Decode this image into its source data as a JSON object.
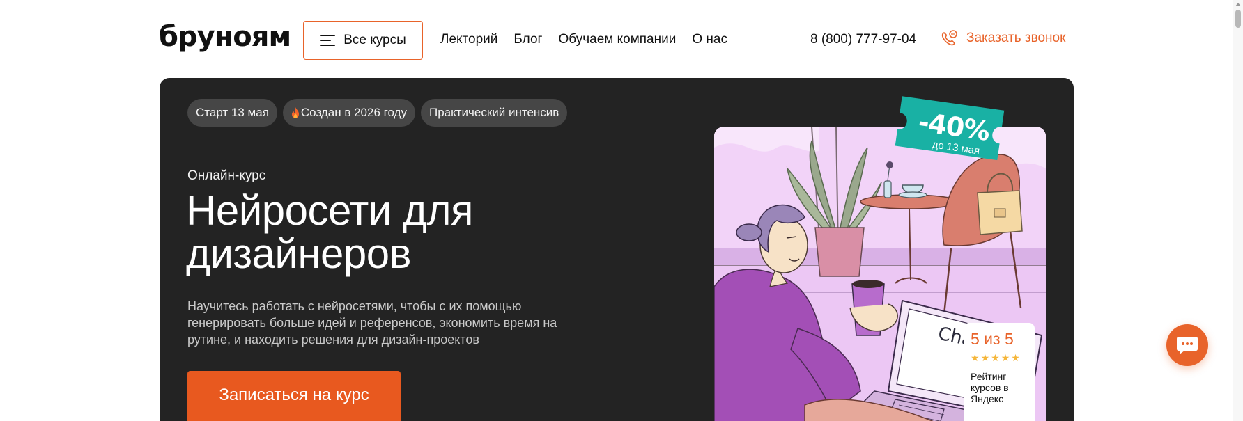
{
  "header": {
    "logo": "бруноям",
    "all_courses_label": "Все курсы",
    "nav": [
      "Лекторий",
      "Блог",
      "Обучаем компании",
      "О нас"
    ],
    "phone": "8 (800) 777-97-04",
    "callback_label": "Заказать звонок"
  },
  "hero": {
    "tags": [
      "Старт 13 мая",
      "Создан в 2026 году",
      "Практический интенсив"
    ],
    "subtitle": "Онлайн-курс",
    "title": "Нейросети для дизайнеров",
    "description": "Научитесь работать с нейросетями, чтобы с их помощью генерировать больше идей и референсов, экономить время на рутине, и находить решения для дизайн-проектов",
    "cta_label": "Записаться на курс"
  },
  "promo": {
    "discount": "-40%",
    "until": "до 13 мая"
  },
  "illustration": {
    "laptop_text": "Chat GPT"
  },
  "rating": {
    "score": "5 из 5",
    "stars": 5,
    "text": "Рейтинг курсов в Яндекс"
  },
  "colors": {
    "accent": "#e8632a",
    "cta": "#e8591f",
    "hero_bg": "#232323",
    "badge": "#19b1a4"
  },
  "icons": {
    "menu": "burger-icon",
    "callback": "phone-callback-icon",
    "tag_flame": "flame-icon",
    "chat": "chat-bubble-icon"
  }
}
